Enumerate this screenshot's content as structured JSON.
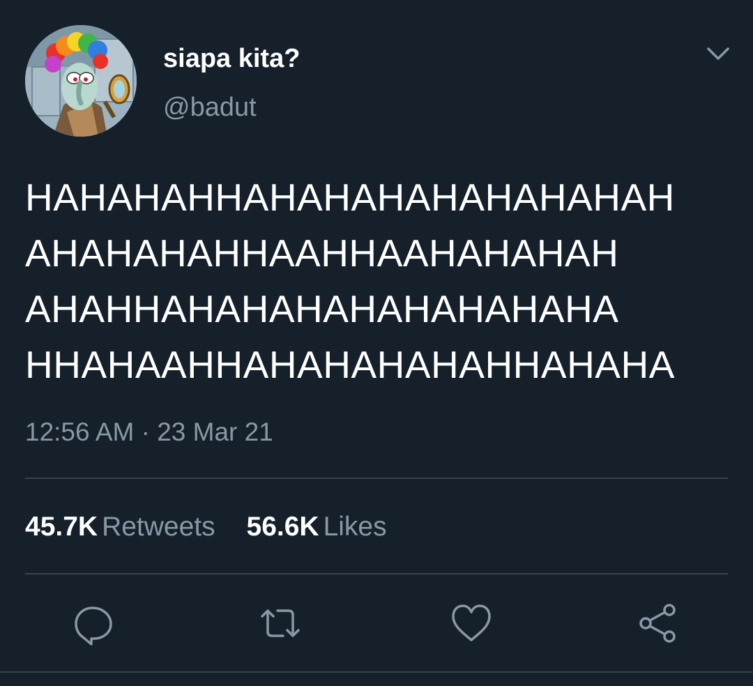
{
  "author": {
    "display_name": "siapa kita?",
    "handle": "@badut",
    "avatar_icon": "squidward-clown-avatar"
  },
  "menu_icon": "chevron-down-icon",
  "tweet": {
    "lines": [
      "HAHAHAHHAHAHAHAHAHAHAHAH",
      "AHAHAHAHHAAHHAAHAHAHAH",
      "AHAHHAHAHAHAHAHAHAHAHA",
      "HHAHAAHHAHAHAHAHAHHAHAHA"
    ],
    "timestamp": "12:56 AM · 23 Mar 21"
  },
  "stats": {
    "retweets_count": "45.7K",
    "retweets_label": "Retweets",
    "likes_count": "56.6K",
    "likes_label": "Likes"
  },
  "actions": [
    {
      "name": "reply",
      "icon": "reply-icon"
    },
    {
      "name": "retweet",
      "icon": "retweet-icon"
    },
    {
      "name": "like",
      "icon": "heart-icon"
    },
    {
      "name": "share",
      "icon": "share-icon"
    }
  ],
  "colors": {
    "background": "#15202b",
    "primary_text": "#ffffff",
    "secondary_text": "#8899a6",
    "divider": "#38444d"
  }
}
